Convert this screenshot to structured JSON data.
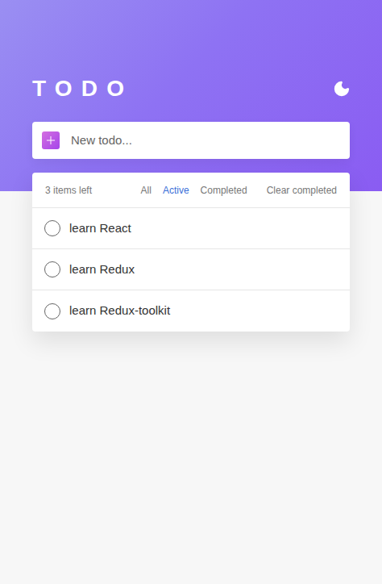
{
  "header": {
    "title": "TODO"
  },
  "input": {
    "placeholder": "New todo..."
  },
  "footer": {
    "items_left": "3 items left",
    "clear": "Clear completed"
  },
  "filters": [
    {
      "label": "All",
      "selected": false
    },
    {
      "label": "Active",
      "selected": true
    },
    {
      "label": "Completed",
      "selected": false
    }
  ],
  "todos": [
    {
      "text": "learn React",
      "completed": false
    },
    {
      "text": "learn Redux",
      "completed": false
    },
    {
      "text": "learn Redux-toolkit",
      "completed": false
    }
  ]
}
